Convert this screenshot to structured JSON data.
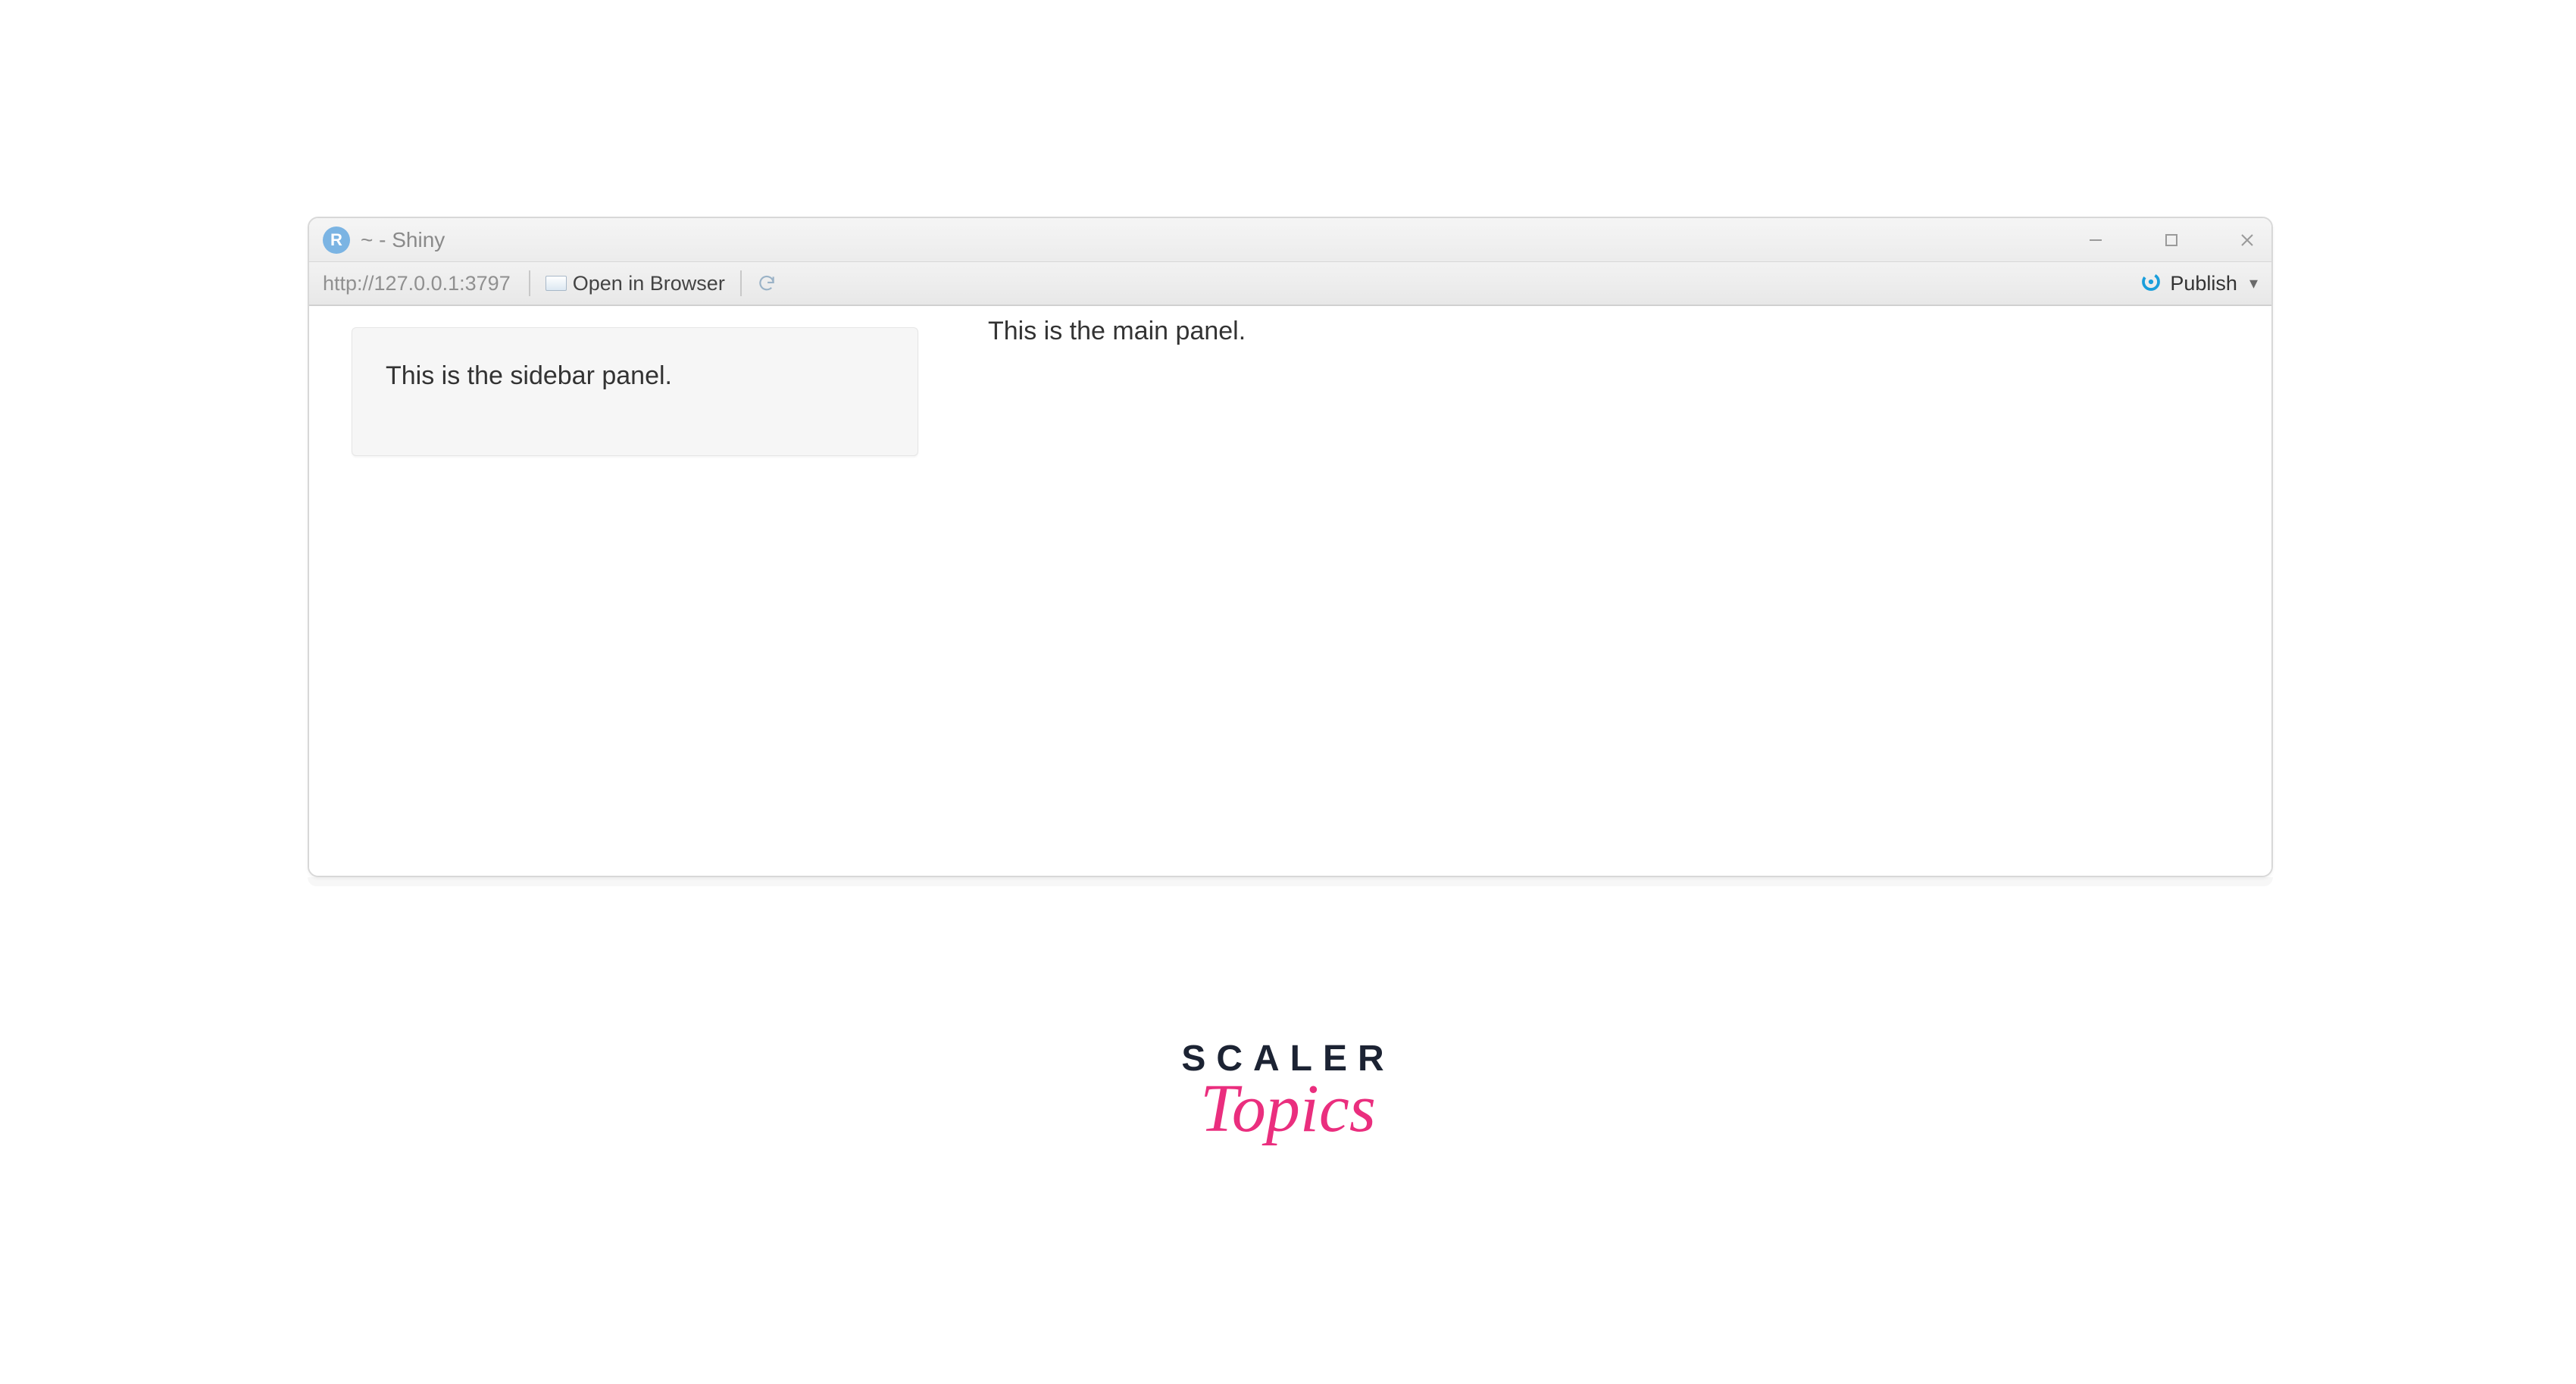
{
  "window": {
    "app_letter": "R",
    "title": "~ - Shiny"
  },
  "toolbar": {
    "url": "http://127.0.0.1:3797",
    "open_browser_label": "Open in Browser",
    "publish_label": "Publish"
  },
  "content": {
    "sidebar_text": "This is the sidebar panel.",
    "main_text": "This is the main panel."
  },
  "logo": {
    "line1": "SCALER",
    "line2": "Topics"
  },
  "colors": {
    "publish_icon": "#1a9edb",
    "logo_pink": "#ea2e7e",
    "logo_dark": "#1c2333"
  }
}
